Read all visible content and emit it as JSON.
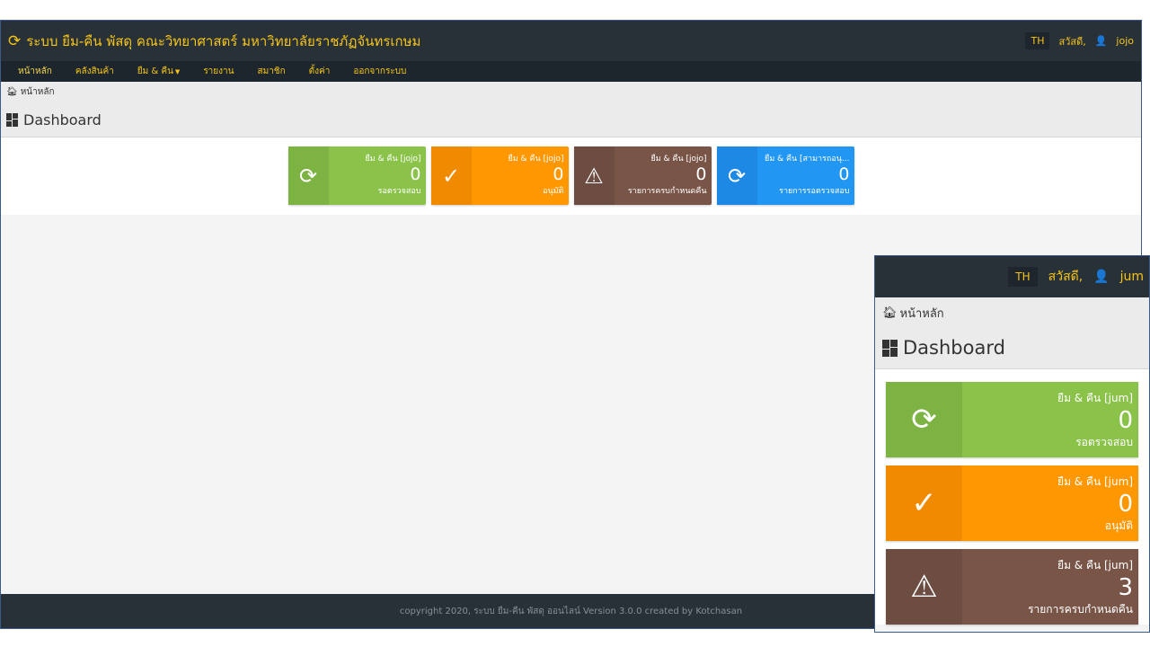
{
  "app": {
    "title": "ระบบ ยืม-คืน พัสดุ คณะวิทยาศาสตร์ มหาวิทยาลัยราชภัฏจันทรเกษม",
    "lang": "TH",
    "greeting": "สวัสดี,",
    "user": "jojo"
  },
  "nav": [
    {
      "label": "หน้าหลัก"
    },
    {
      "label": "คลังสินค้า"
    },
    {
      "label": "ยืม & คืน"
    },
    {
      "label": "รายงาน"
    },
    {
      "label": "สมาชิก"
    },
    {
      "label": "ตั้งค่า"
    },
    {
      "label": "ออกจากระบบ"
    }
  ],
  "breadcrumb": "หน้าหลัก",
  "page_title": "Dashboard",
  "cards": [
    {
      "title": "ยืม & คืน [jojo]",
      "count": "0",
      "caption": "รอตรวจสอบ",
      "icon": "refresh-icon",
      "color": "#8bc34a"
    },
    {
      "title": "ยืม & คืน [jojo]",
      "count": "0",
      "caption": "อนุมัติ",
      "icon": "check-icon",
      "color": "#ff9800"
    },
    {
      "title": "ยืม & คืน [jojo]",
      "count": "0",
      "caption": "รายการครบกำหนดคืน",
      "icon": "warning-icon",
      "color": "#795548"
    },
    {
      "title": "ยืม & คืน [สามารถอนุ...",
      "count": "0",
      "caption": "รายการรอตรวจสอบ",
      "icon": "refresh-icon",
      "color": "#2196f3"
    }
  ],
  "footer": "copyright 2020, ระบบ ยืม-คืน พัสดุ ออนไลน์ Version 3.0.0 created by Kotchasan",
  "zoom": {
    "lang": "TH",
    "greeting": "สวัสดี,",
    "user": "jum",
    "breadcrumb": "หน้าหลัก",
    "page_title": "Dashboard",
    "cards": [
      {
        "title": "ยืม & คืน [jum]",
        "count": "0",
        "caption": "รอตรวจสอบ",
        "icon": "refresh-icon",
        "color": "#8bc34a"
      },
      {
        "title": "ยืม & คืน [jum]",
        "count": "0",
        "caption": "อนุมัติ",
        "icon": "check-icon",
        "color": "#ff9800"
      },
      {
        "title": "ยืม & คืน [jum]",
        "count": "3",
        "caption": "รายการครบกำหนดคืน",
        "icon": "warning-icon",
        "color": "#795548"
      }
    ]
  }
}
